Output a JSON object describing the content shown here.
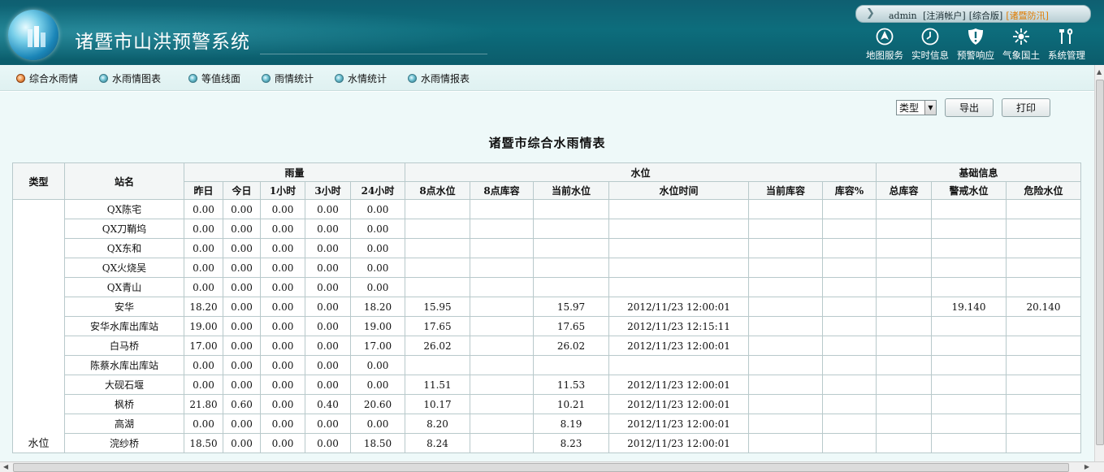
{
  "header": {
    "app_title": "诸暨市山洪预警系统",
    "account": {
      "user": "admin",
      "logout": "[注消帐户]",
      "edition": "[综合版]",
      "alert": "[诸暨防汛]"
    },
    "nav": [
      {
        "label": "地图服务",
        "icon": "map-nav-icon"
      },
      {
        "label": "实时信息",
        "icon": "clock-icon"
      },
      {
        "label": "预警响应",
        "icon": "warning-shield-icon"
      },
      {
        "label": "气象国土",
        "icon": "weather-sun-icon"
      },
      {
        "label": "系统管理",
        "icon": "tools-icon"
      }
    ]
  },
  "tabs": [
    {
      "label": "综合水雨情",
      "active": true
    },
    {
      "label": "水雨情图表",
      "active": false
    },
    {
      "label": "等值线面",
      "active": false
    },
    {
      "label": "雨情统计",
      "active": false
    },
    {
      "label": "水情统计",
      "active": false
    },
    {
      "label": "水雨情报表",
      "active": false
    }
  ],
  "toolbar": {
    "type_select": "类型",
    "export": "导出",
    "print": "打印"
  },
  "report": {
    "title": "诸暨市综合水雨情表",
    "headers": {
      "type": "类型",
      "station": "站名",
      "group_rain": "雨量",
      "group_water": "水位",
      "group_base": "基础信息",
      "rain": [
        "昨日",
        "今日",
        "1小时",
        "3小时",
        "24小时"
      ],
      "water": [
        "8点水位",
        "8点库容",
        "当前水位",
        "水位时间",
        "当前库容",
        "库容%"
      ],
      "base": [
        "总库容",
        "警戒水位",
        "危险水位"
      ]
    },
    "type_label": "水位",
    "rows": [
      [
        "QX陈宅",
        "0.00",
        "0.00",
        "0.00",
        "0.00",
        "0.00",
        "",
        "",
        "",
        "",
        "",
        "",
        "",
        "",
        ""
      ],
      [
        "QX刀鞘坞",
        "0.00",
        "0.00",
        "0.00",
        "0.00",
        "0.00",
        "",
        "",
        "",
        "",
        "",
        "",
        "",
        "",
        ""
      ],
      [
        "QX东和",
        "0.00",
        "0.00",
        "0.00",
        "0.00",
        "0.00",
        "",
        "",
        "",
        "",
        "",
        "",
        "",
        "",
        ""
      ],
      [
        "QX火烧吴",
        "0.00",
        "0.00",
        "0.00",
        "0.00",
        "0.00",
        "",
        "",
        "",
        "",
        "",
        "",
        "",
        "",
        ""
      ],
      [
        "QX青山",
        "0.00",
        "0.00",
        "0.00",
        "0.00",
        "0.00",
        "",
        "",
        "",
        "",
        "",
        "",
        "",
        "",
        ""
      ],
      [
        "安华",
        "18.20",
        "0.00",
        "0.00",
        "0.00",
        "18.20",
        "15.95",
        "",
        "15.97",
        "2012/11/23 12:00:01",
        "",
        "",
        "",
        "19.140",
        "20.140"
      ],
      [
        "安华水库出库站",
        "19.00",
        "0.00",
        "0.00",
        "0.00",
        "19.00",
        "17.65",
        "",
        "17.65",
        "2012/11/23 12:15:11",
        "",
        "",
        "",
        "",
        ""
      ],
      [
        "白马桥",
        "17.00",
        "0.00",
        "0.00",
        "0.00",
        "17.00",
        "26.02",
        "",
        "26.02",
        "2012/11/23 12:00:01",
        "",
        "",
        "",
        "",
        ""
      ],
      [
        "陈蔡水库出库站",
        "0.00",
        "0.00",
        "0.00",
        "0.00",
        "0.00",
        "",
        "",
        "",
        "",
        "",
        "",
        "",
        "",
        ""
      ],
      [
        "大砚石堰",
        "0.00",
        "0.00",
        "0.00",
        "0.00",
        "0.00",
        "11.51",
        "",
        "11.53",
        "2012/11/23 12:00:01",
        "",
        "",
        "",
        "",
        ""
      ],
      [
        "枫桥",
        "21.80",
        "0.60",
        "0.00",
        "0.40",
        "20.60",
        "10.17",
        "",
        "10.21",
        "2012/11/23 12:00:01",
        "",
        "",
        "",
        "",
        ""
      ],
      [
        "高湖",
        "0.00",
        "0.00",
        "0.00",
        "0.00",
        "0.00",
        "8.20",
        "",
        "8.19",
        "2012/11/23 12:00:01",
        "",
        "",
        "",
        "",
        ""
      ],
      [
        "浣纱桥",
        "18.50",
        "0.00",
        "0.00",
        "0.00",
        "18.50",
        "8.24",
        "",
        "8.23",
        "2012/11/23 12:00:01",
        "",
        "",
        "",
        "",
        ""
      ]
    ]
  },
  "colors": {
    "header_bg": "#0d6d7c",
    "alert": "#e07b00",
    "tab_active": "#f09a52"
  }
}
